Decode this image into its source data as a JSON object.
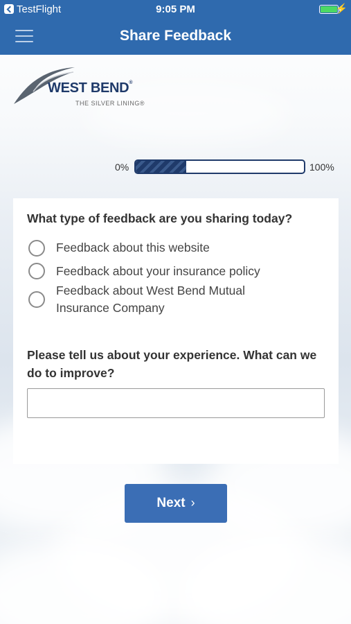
{
  "status_bar": {
    "back_app": "TestFlight",
    "time": "9:05 PM"
  },
  "nav": {
    "title": "Share Feedback",
    "menu_icon": "hamburger-menu-icon"
  },
  "logo": {
    "wordmark": "WEST BEND",
    "tagline": "THE SILVER LINING®"
  },
  "progress": {
    "start_label": "0%",
    "end_label": "100%",
    "value_percent": 30
  },
  "form": {
    "question1": "What type of feedback are you sharing today?",
    "options": [
      {
        "label_line1": "Feedback about this website",
        "label_line2": ""
      },
      {
        "label_line1": "Feedback about your insurance policy",
        "label_line2": ""
      },
      {
        "label_line1": "Feedback about West Bend Mutual",
        "label_line2": "Insurance Company"
      }
    ],
    "question2": "Please tell us about your experience. What can we do to improve?",
    "response_value": ""
  },
  "next_button": {
    "label": "Next",
    "icon": "chevron-right-icon"
  },
  "colors": {
    "header_blue": "#2f6aae",
    "button_blue": "#3b6eb5",
    "progress_navy": "#1f3a6a",
    "battery_green": "#4cd964"
  }
}
